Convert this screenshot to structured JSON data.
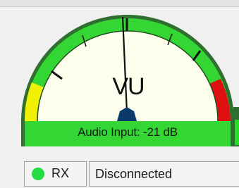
{
  "vu_meter": {
    "scale_text": "VU",
    "readout_label": "Audio Input: -21 dB",
    "zones": [
      "yellow",
      "green",
      "red"
    ],
    "colors": {
      "green": "#33d633",
      "yellow": "#f0f000",
      "red": "#e01010",
      "face": "#ffffee",
      "needle": "#111111",
      "pivot": "#0a3a6a",
      "label_bg": "#22e022"
    }
  },
  "status": {
    "rx_label": "RX",
    "rx_indicator_color": "#22dd44",
    "connection_status": "Disconnected"
  }
}
